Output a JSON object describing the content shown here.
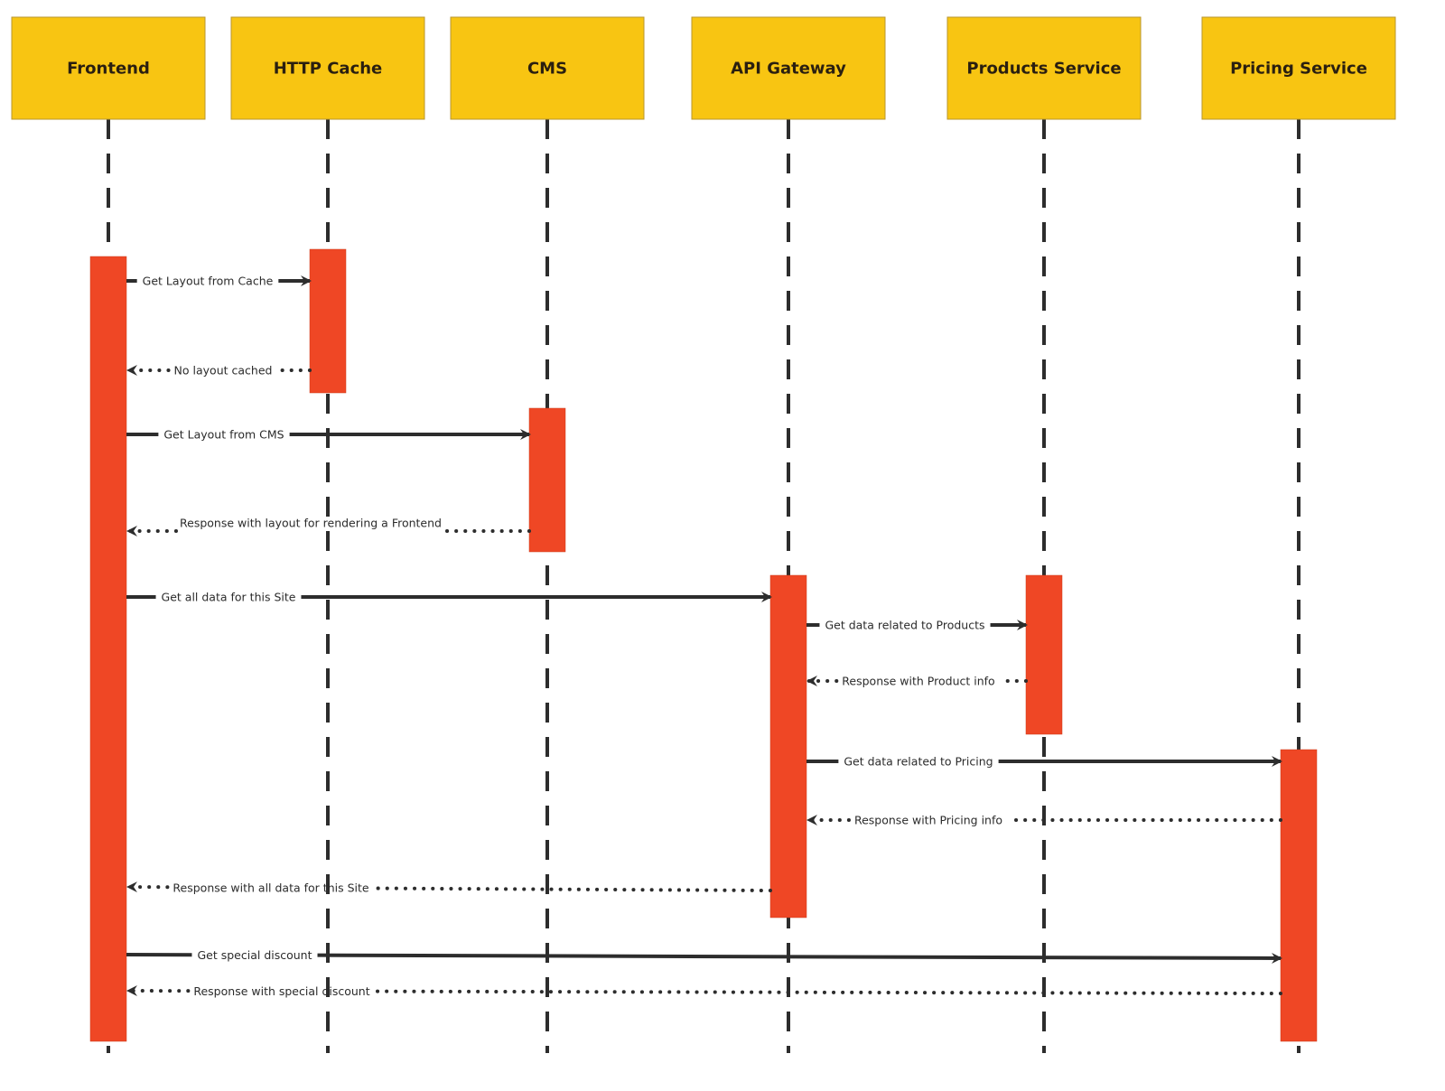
{
  "diagram": {
    "type": "sequence",
    "colors": {
      "participant_fill": "#F8C512",
      "participant_border": "#B8962E",
      "activation_fill": "#EF4725",
      "line": "#2d2d2d",
      "text": "#2a1f10"
    },
    "participants": [
      {
        "id": "frontend",
        "label": "Frontend"
      },
      {
        "id": "http-cache",
        "label": "HTTP Cache"
      },
      {
        "id": "cms",
        "label": "CMS"
      },
      {
        "id": "api-gateway",
        "label": "API Gateway"
      },
      {
        "id": "products-service",
        "label": "Products Service"
      },
      {
        "id": "pricing-service",
        "label": "Pricing Service"
      }
    ],
    "messages": [
      {
        "from": "frontend",
        "to": "http-cache",
        "kind": "call",
        "label": "Get Layout from Cache"
      },
      {
        "from": "http-cache",
        "to": "frontend",
        "kind": "return",
        "label": "No layout cached"
      },
      {
        "from": "frontend",
        "to": "cms",
        "kind": "call",
        "label": "Get Layout from CMS"
      },
      {
        "from": "cms",
        "to": "frontend",
        "kind": "return",
        "label": "Response with layout for rendering a Frontend"
      },
      {
        "from": "frontend",
        "to": "api-gateway",
        "kind": "call",
        "label": "Get all data for this Site"
      },
      {
        "from": "api-gateway",
        "to": "products-service",
        "kind": "call",
        "label": "Get data related to Products"
      },
      {
        "from": "products-service",
        "to": "api-gateway",
        "kind": "return",
        "label": "Response with Product info"
      },
      {
        "from": "api-gateway",
        "to": "pricing-service",
        "kind": "call",
        "label": "Get data related to Pricing"
      },
      {
        "from": "pricing-service",
        "to": "api-gateway",
        "kind": "return",
        "label": "Response with Pricing info"
      },
      {
        "from": "api-gateway",
        "to": "frontend",
        "kind": "return",
        "label": "Response with all data for this Site"
      },
      {
        "from": "frontend",
        "to": "pricing-service",
        "kind": "call",
        "label": "Get special discount"
      },
      {
        "from": "pricing-service",
        "to": "frontend",
        "kind": "return",
        "label": "Response with special discount"
      }
    ]
  }
}
